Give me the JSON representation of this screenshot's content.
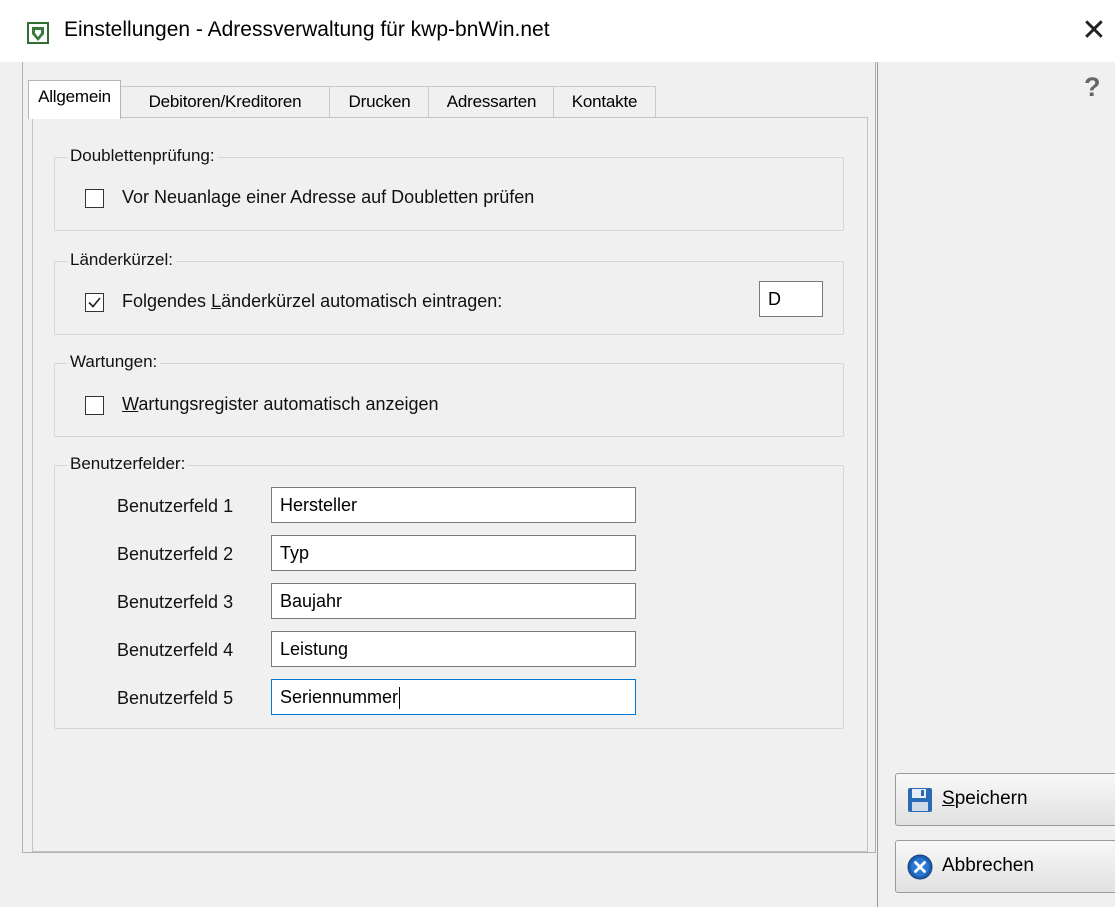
{
  "window": {
    "title": "Einstellungen - Adressverwaltung für kwp-bnWin.net",
    "close_glyph": "✕",
    "icon": "app-shield-icon"
  },
  "help": {
    "glyph": "?"
  },
  "tabs": [
    {
      "label": "Allgemein",
      "active": true
    },
    {
      "label": "Debitoren/Kreditoren",
      "active": false
    },
    {
      "label": "Drucken",
      "active": false
    },
    {
      "label": "Adressarten",
      "active": false
    },
    {
      "label": "Kontakte",
      "active": false
    }
  ],
  "doubletten": {
    "title": "Doublettenprüfung:",
    "checkbox_label": "Vor Neuanlage einer Adresse auf Doubletten prüfen",
    "checked": false
  },
  "laender": {
    "title": "Länderkürzel:",
    "label_pre": "Folgendes ",
    "label_mnemonic": "L",
    "label_post": "änderkürzel automatisch eintragen:",
    "checked": true,
    "value": "D"
  },
  "wartungen": {
    "title": "Wartungen:",
    "label_mnemonic": "W",
    "label_post": "artungsregister automatisch anzeigen",
    "checked": false
  },
  "benutzerfelder": {
    "title": "Benutzerfelder:",
    "fields": [
      {
        "label": "Benutzerfeld 1",
        "value": "Hersteller"
      },
      {
        "label": "Benutzerfeld 2",
        "value": "Typ"
      },
      {
        "label": "Benutzerfeld 3",
        "value": "Baujahr"
      },
      {
        "label": "Benutzerfeld 4",
        "value": "Leistung"
      },
      {
        "label": "Benutzerfeld 5",
        "value": "Seriennummer",
        "focused": true
      }
    ]
  },
  "buttons": {
    "save_mnemonic": "S",
    "save_rest": "peichern",
    "save_icon": "floppy-disk-icon",
    "cancel_label": "Abbrechen",
    "cancel_icon": "cancel-x-icon"
  },
  "colors": {
    "focus_border": "#0078d7",
    "save_icon_blue": "#2a6ab6",
    "cancel_icon_blue": "#1d5fb3"
  }
}
